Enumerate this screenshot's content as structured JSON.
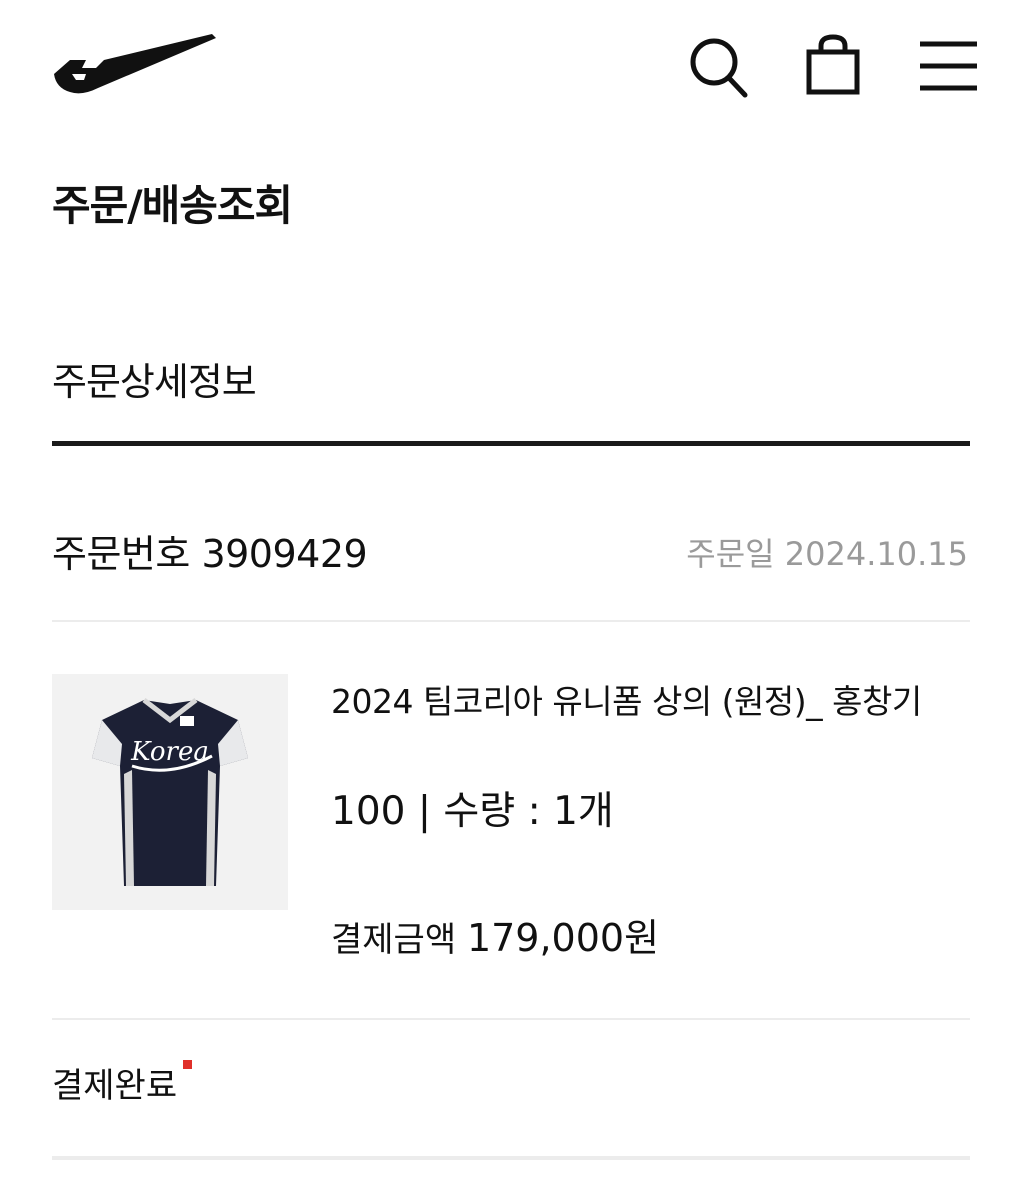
{
  "header": {
    "logo_icon": "brand-swoosh-logo",
    "icons": [
      "search-icon",
      "shopping-bag-icon",
      "menu-icon"
    ]
  },
  "page": {
    "title": "주문/배송조회"
  },
  "detail": {
    "section_title": "주문상세정보",
    "order_number_label": "주문번호",
    "order_number": "3909429",
    "order_date_label": "주문일",
    "order_date": "2024.10.15"
  },
  "product": {
    "image_icon": "jersey-thumbnail",
    "name": "2024 팀코리아 유니폼 상의 (원정)_ 홍창기",
    "size": "100",
    "separator": "|",
    "quantity_label": "수량 :",
    "quantity": "1개",
    "payment_label": "결제금액",
    "payment_amount": "179,000원"
  },
  "status": {
    "label": "결제완료",
    "dot_color": "#e0302a"
  },
  "colors": {
    "text": "#111111",
    "muted": "#9a9a9a",
    "rule": "#1a1a1a",
    "thin_rule": "#ececec"
  }
}
